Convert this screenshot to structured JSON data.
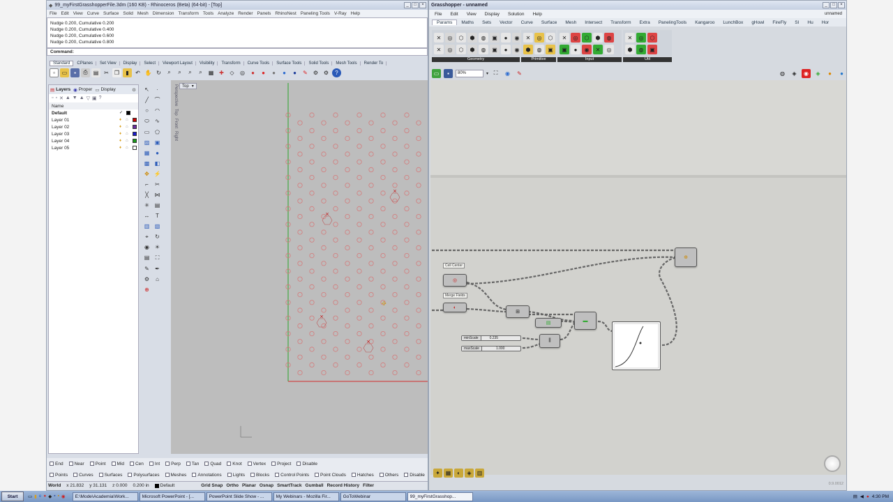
{
  "rhino": {
    "title": "99_myFirstGrasshopperFile.3dm (160 KB) - Rhinoceros (Beta) (64-bit) - [Top]",
    "menu": [
      "File",
      "Edit",
      "View",
      "Curve",
      "Surface",
      "Solid",
      "Mesh",
      "Dimension",
      "Transform",
      "Tools",
      "Analyze",
      "Render",
      "Panels",
      "RhinoNest",
      "Paneling Tools",
      "V-Ray",
      "Help"
    ],
    "history": [
      "Nudge 0.200, Cumulative 0.200",
      "Nudge 0.200, Cumulative 0.400",
      "Nudge 0.200, Cumulative 0.600",
      "Nudge 0.200, Cumulative 0.800"
    ],
    "command_label": "Command:",
    "toolbar_tabs": [
      "Standard",
      "CPlanes",
      "Set View",
      "Display",
      "Select",
      "Viewport Layout",
      "Visibility",
      "Transform",
      "Curve Tools",
      "Surface Tools",
      "Solid Tools",
      "Mesh Tools",
      "Render To"
    ],
    "panel_tabs": [
      "Layers",
      "Proper",
      "Display"
    ],
    "layer_header": "Name",
    "layers": [
      {
        "name": "Default",
        "color": "#000000",
        "current": true
      },
      {
        "name": "Layer 01",
        "color": "#cc0000",
        "current": false
      },
      {
        "name": "Layer 02",
        "color": "#6a2ca0",
        "current": false
      },
      {
        "name": "Layer 03",
        "color": "#1a1acc",
        "current": false
      },
      {
        "name": "Layer 04",
        "color": "#1a9a1a",
        "current": false
      },
      {
        "name": "Layer 05",
        "color": "#ffffff",
        "current": false
      }
    ],
    "viewport_tag": "Top",
    "viewport_side_tabs": [
      "Perspective",
      "Top",
      "Front",
      "Right"
    ],
    "osnap_row1": [
      "End",
      "Near",
      "Point",
      "Mid",
      "Cen",
      "Int",
      "Perp",
      "Tan",
      "Quad",
      "Knot",
      "Vertex",
      "Project",
      "Disable"
    ],
    "osnap_row2": [
      "Points",
      "Curves",
      "Surfaces",
      "Polysurfaces",
      "Meshes",
      "Annotations",
      "Lights",
      "Blocks",
      "Control Points",
      "Point Clouds",
      "Hatches",
      "Others",
      "Disable"
    ],
    "status": {
      "cplane": "World",
      "x": "x 21.832",
      "y": "y 31.131",
      "z": "z 0.000",
      "units": "0.200 in",
      "layer": "Default",
      "modes": [
        "Grid Snap",
        "Ortho",
        "Planar",
        "Osnap",
        "SmartTrack",
        "Gumball",
        "Record History",
        "Filter"
      ]
    }
  },
  "gh": {
    "title": "Grasshopper - unnamed",
    "doc_name": "unnamed",
    "menu": [
      "File",
      "Edit",
      "View",
      "Display",
      "Solution",
      "Help"
    ],
    "tabs": [
      "Params",
      "Maths",
      "Sets",
      "Vector",
      "Curve",
      "Surface",
      "Mesh",
      "Intersect",
      "Transform",
      "Extra",
      "PanelingTools",
      "Kangaroo",
      "LunchBox",
      "gHowl",
      "FireFly",
      "SI",
      "Hu",
      "Hor"
    ],
    "ribbon_groups": [
      "Geometry",
      "Primitive",
      "Input",
      "Util"
    ],
    "zoom": "80%",
    "labels": {
      "cell_centers": "Cell Center",
      "merge_fields": "Merge Fields"
    },
    "sliders": [
      {
        "name": "minScale",
        "value": "0.235"
      },
      {
        "name": "maxScale",
        "value": "1.000"
      }
    ],
    "version": "0.9.0012"
  },
  "taskbar": {
    "start": "Start",
    "tasks": [
      "E:\\Mode\\Academia\\Work...",
      "Microsoft PowerPoint - [...",
      "PowerPoint Slide Show - ...",
      "My Webinars - Mozilla Fir...",
      "GoToWebinar",
      "99_myFirstGrasshop..."
    ],
    "clock": "4:30 PM"
  }
}
